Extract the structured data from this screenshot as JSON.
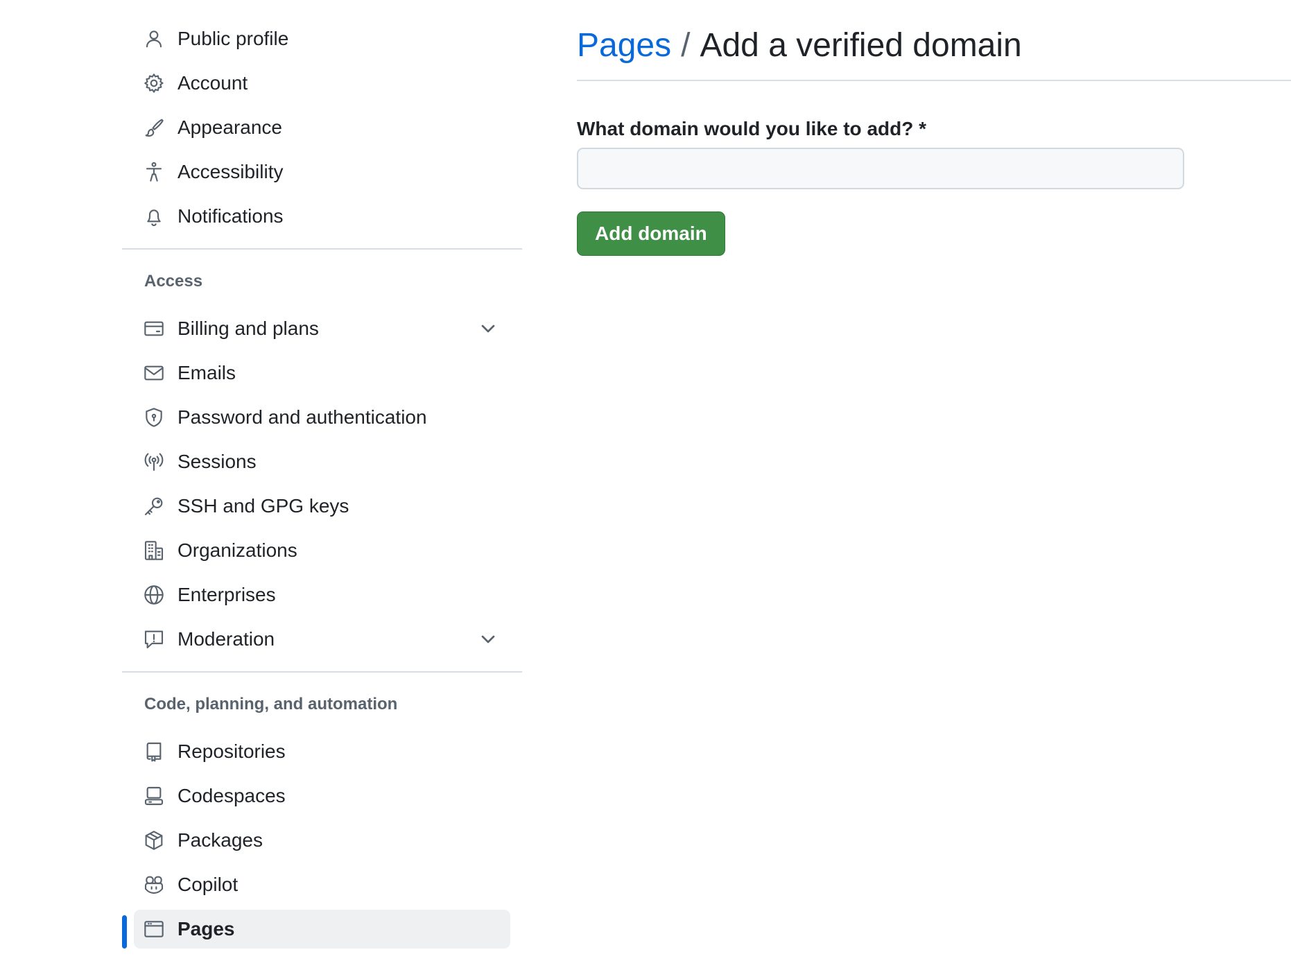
{
  "sidebar": {
    "personal": [
      {
        "label": "Public profile",
        "icon": "person-icon"
      },
      {
        "label": "Account",
        "icon": "gear-icon"
      },
      {
        "label": "Appearance",
        "icon": "paintbrush-icon"
      },
      {
        "label": "Accessibility",
        "icon": "accessibility-icon"
      },
      {
        "label": "Notifications",
        "icon": "bell-icon"
      }
    ],
    "access": {
      "heading": "Access",
      "items": [
        {
          "label": "Billing and plans",
          "icon": "credit-card-icon",
          "expandable": true
        },
        {
          "label": "Emails",
          "icon": "mail-icon"
        },
        {
          "label": "Password and authentication",
          "icon": "shield-lock-icon"
        },
        {
          "label": "Sessions",
          "icon": "broadcast-icon"
        },
        {
          "label": "SSH and GPG keys",
          "icon": "key-icon"
        },
        {
          "label": "Organizations",
          "icon": "organization-icon"
        },
        {
          "label": "Enterprises",
          "icon": "globe-icon"
        },
        {
          "label": "Moderation",
          "icon": "report-icon",
          "expandable": true
        }
      ]
    },
    "code": {
      "heading": "Code, planning, and automation",
      "items": [
        {
          "label": "Repositories",
          "icon": "repo-icon"
        },
        {
          "label": "Codespaces",
          "icon": "codespaces-icon"
        },
        {
          "label": "Packages",
          "icon": "package-icon"
        },
        {
          "label": "Copilot",
          "icon": "copilot-icon"
        },
        {
          "label": "Pages",
          "icon": "browser-icon",
          "active": true
        }
      ]
    }
  },
  "main": {
    "breadcrumb": {
      "parent": "Pages",
      "separator": "/",
      "current": "Add a verified domain"
    },
    "form": {
      "label": "What domain would you like to add? *",
      "input_value": "",
      "input_placeholder": "",
      "submit_label": "Add domain"
    }
  },
  "colors": {
    "link": "#0969da",
    "primary_button": "#3f8f47",
    "active_indicator": "#0969da",
    "active_background": "#eef0f2"
  }
}
